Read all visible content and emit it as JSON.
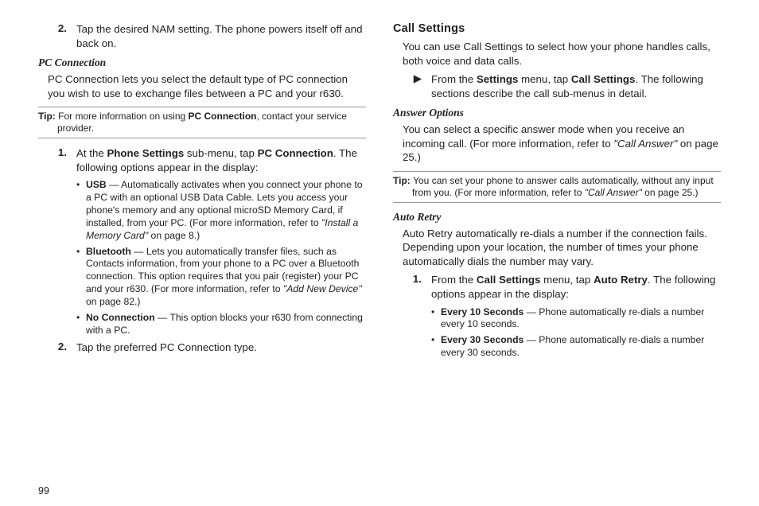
{
  "page_number": "99",
  "left": {
    "step2": {
      "num": "2.",
      "text_a": "Tap the desired NAM setting. The phone powers itself off and back on."
    },
    "pc_head": "PC Connection",
    "pc_intro": "PC Connection lets you select the default type of PC connection you wish to use to exchange files between a PC and your r630.",
    "tip_label": "Tip: ",
    "tip_a": "For more information on using ",
    "tip_b": "PC Connection",
    "tip_c": ", contact your service provider.",
    "step1": {
      "num": "1.",
      "a": "At the ",
      "b": "Phone Settings",
      "c": " sub-menu, tap ",
      "d": "PC Connection",
      "e": ". The following options appear in the display:"
    },
    "usb": {
      "b": "USB",
      "t1": " — Automatically activates when you connect your phone to a PC with an optional USB Data Cable. Lets you access your phone's memory and any optional microSD Memory Card, if installed, from your PC. (For more information, refer to ",
      "ref": "\"Install a Memory Card\"",
      "t2": "  on page 8.)"
    },
    "bt": {
      "b": "Bluetooth",
      "t1": " — Lets you automatically transfer files, such as Contacts information, from your phone to a PC over a Bluetooth connection. This option requires that you pair (register) your PC and your r630. (For more information, refer to ",
      "ref": "\"Add New Device\"",
      "t2": "  on page 82.)"
    },
    "noc": {
      "b": "No Connection",
      "t1": " — This option blocks your r630 from connecting with a PC."
    },
    "step2b": {
      "num": "2.",
      "text": "Tap the preferred PC Connection type."
    }
  },
  "right": {
    "cs_head": "Call Settings",
    "cs_intro": "You can use Call Settings to select how your phone handles calls, both voice and data calls.",
    "arrow": {
      "sym": "▶",
      "a": "From the ",
      "b": "Settings",
      "c": " menu, tap ",
      "d": "Call Settings",
      "e": ". The following sections describe the call sub-menus in detail."
    },
    "ao_head": "Answer Options",
    "ao_a": "You can select a specific answer mode when you receive an incoming call. (For more information, refer to ",
    "ao_ref": "\"Call Answer\"",
    "ao_b": "  on page 25.)",
    "tip_label": "Tip: ",
    "tip_a": "You can set your phone to answer calls automatically, without any input from you. (For more information, refer to ",
    "tip_ref": "\"Call Answer\"",
    "tip_b": "  on page 25.)",
    "ar_head": "Auto Retry",
    "ar_intro": "Auto Retry automatically re-dials a number if the connection fails. Depending upon your location, the number of times your phone automatically dials the number may vary.",
    "step1": {
      "num": "1.",
      "a": "From the ",
      "b": "Call Settings",
      "c": " menu, tap ",
      "d": "Auto Retry",
      "e": ". The following options appear in the display:"
    },
    "e10": {
      "b": "Every 10 Seconds",
      "t": " — Phone automatically re-dials a number every 10 seconds."
    },
    "e30": {
      "b": "Every 30 Seconds",
      "t": " — Phone automatically re-dials a number every 30 seconds."
    }
  }
}
